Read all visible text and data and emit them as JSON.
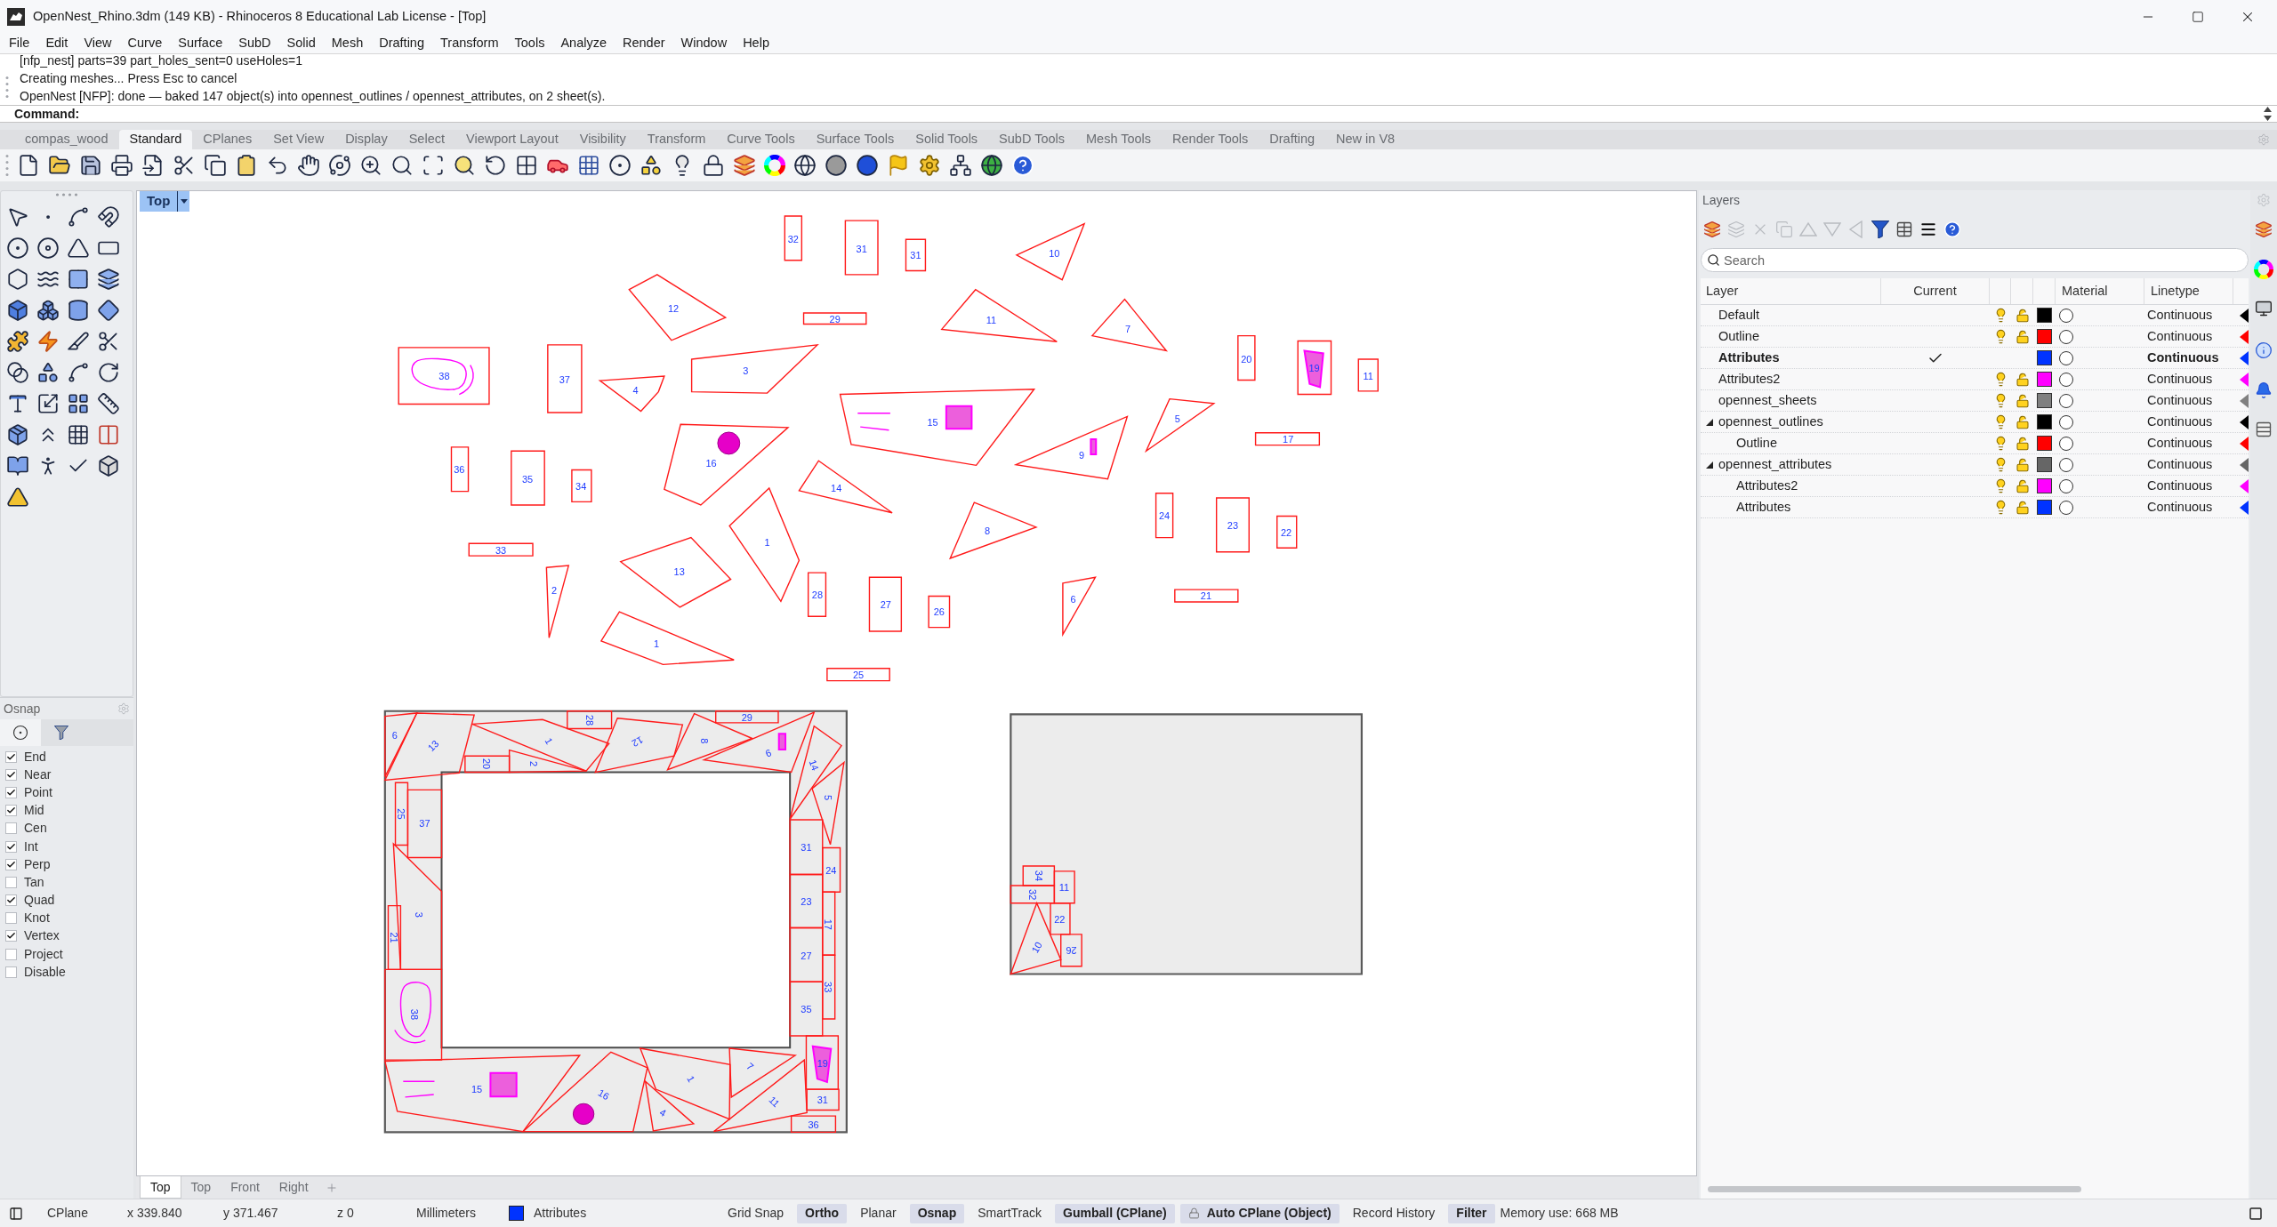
{
  "window": {
    "title": "OpenNest_Rhino.3dm (149 KB) - Rhinoceros 8 Educational Lab License - [Top]"
  },
  "menu": [
    "File",
    "Edit",
    "View",
    "Curve",
    "Surface",
    "SubD",
    "Solid",
    "Mesh",
    "Drafting",
    "Transform",
    "Tools",
    "Analyze",
    "Render",
    "Window",
    "Help"
  ],
  "command_history": [
    "[nfp_nest] parts=39 part_holes_sent=0 useHoles=1",
    "Creating meshes... Press Esc to cancel",
    "OpenNest [NFP]: done — baked 147 object(s) into opennest_outlines / opennest_attributes, on 2 sheet(s)."
  ],
  "command_prompt": "Command:",
  "toolbar_tabs": [
    {
      "label": "compas_wood",
      "selected": false
    },
    {
      "label": "Standard",
      "selected": true
    },
    {
      "label": "CPlanes",
      "selected": false
    },
    {
      "label": "Set View",
      "selected": false
    },
    {
      "label": "Display",
      "selected": false
    },
    {
      "label": "Select",
      "selected": false
    },
    {
      "label": "Viewport Layout",
      "selected": false
    },
    {
      "label": "Visibility",
      "selected": false
    },
    {
      "label": "Transform",
      "selected": false
    },
    {
      "label": "Curve Tools",
      "selected": false
    },
    {
      "label": "Surface Tools",
      "selected": false
    },
    {
      "label": "Solid Tools",
      "selected": false
    },
    {
      "label": "SubD Tools",
      "selected": false
    },
    {
      "label": "Mesh Tools",
      "selected": false
    },
    {
      "label": "Render Tools",
      "selected": false
    },
    {
      "label": "Drafting",
      "selected": false
    },
    {
      "label": "New in V8",
      "selected": false
    }
  ],
  "viewport": {
    "title": "Top",
    "parts": [
      {
        "label": "32"
      },
      {
        "label": "31"
      },
      {
        "label": "31"
      },
      {
        "label": "10"
      },
      {
        "label": "12"
      },
      {
        "label": "29"
      },
      {
        "label": "11"
      },
      {
        "label": "7"
      },
      {
        "label": "38"
      },
      {
        "label": "37"
      },
      {
        "label": "4"
      },
      {
        "label": "3"
      },
      {
        "label": "20"
      },
      {
        "label": "19"
      },
      {
        "label": "11"
      },
      {
        "label": "15"
      },
      {
        "label": "5"
      },
      {
        "label": "17"
      },
      {
        "label": "36"
      },
      {
        "label": "35"
      },
      {
        "label": "34"
      },
      {
        "label": "16"
      },
      {
        "label": "14"
      },
      {
        "label": "9"
      },
      {
        "label": "33"
      },
      {
        "label": "1"
      },
      {
        "label": "8"
      },
      {
        "label": "24"
      },
      {
        "label": "23"
      },
      {
        "label": "22"
      },
      {
        "label": "2"
      },
      {
        "label": "13"
      },
      {
        "label": "28"
      },
      {
        "label": "27"
      },
      {
        "label": "26"
      },
      {
        "label": "6"
      },
      {
        "label": "21"
      },
      {
        "label": "1"
      },
      {
        "label": "25"
      }
    ],
    "sheets": [
      {
        "parts": [
          {
            "label": "28"
          },
          {
            "label": "29"
          },
          {
            "label": "6"
          },
          {
            "label": "13"
          },
          {
            "label": "20"
          },
          {
            "label": "2"
          },
          {
            "label": "1"
          },
          {
            "label": "12"
          },
          {
            "label": "8"
          },
          {
            "label": "9"
          },
          {
            "label": "14"
          },
          {
            "label": "5"
          },
          {
            "label": "25"
          },
          {
            "label": "37"
          },
          {
            "label": "31"
          },
          {
            "label": "24"
          },
          {
            "label": "3"
          },
          {
            "label": "23"
          },
          {
            "label": "21"
          },
          {
            "label": "17"
          },
          {
            "label": "27"
          },
          {
            "label": "33"
          },
          {
            "label": "38"
          },
          {
            "label": "35"
          },
          {
            "label": "15"
          },
          {
            "label": "16"
          },
          {
            "label": "4"
          },
          {
            "label": "1"
          },
          {
            "label": "7"
          },
          {
            "label": "11"
          },
          {
            "label": "36"
          },
          {
            "label": "19"
          },
          {
            "label": "31"
          }
        ]
      },
      {
        "parts": [
          {
            "label": "34"
          },
          {
            "label": "32"
          },
          {
            "label": "11"
          },
          {
            "label": "22"
          },
          {
            "label": "10"
          },
          {
            "label": "26"
          }
        ]
      }
    ]
  },
  "view_tabs": [
    {
      "label": "Top",
      "selected": true
    },
    {
      "label": "Top",
      "selected": false
    },
    {
      "label": "Front",
      "selected": false
    },
    {
      "label": "Right",
      "selected": false
    }
  ],
  "osnap": {
    "title": "Osnap",
    "tabs": [
      {
        "kind": "snap",
        "selected": true
      },
      {
        "kind": "filter",
        "selected": false
      }
    ],
    "items": [
      {
        "label": "End",
        "checked": true
      },
      {
        "label": "Near",
        "checked": true
      },
      {
        "label": "Point",
        "checked": true
      },
      {
        "label": "Mid",
        "checked": true
      },
      {
        "label": "Cen",
        "checked": false
      },
      {
        "label": "Int",
        "checked": true
      },
      {
        "label": "Perp",
        "checked": true
      },
      {
        "label": "Tan",
        "checked": false
      },
      {
        "label": "Quad",
        "checked": true
      },
      {
        "label": "Knot",
        "checked": false
      },
      {
        "label": "Vertex",
        "checked": true
      },
      {
        "label": "Project",
        "checked": false
      },
      {
        "label": "Disable",
        "checked": false
      }
    ]
  },
  "layers": {
    "title": "Layers",
    "search": {
      "placeholder": "Search"
    },
    "columns": {
      "layer": "Layer",
      "current": "Current",
      "material": "Material",
      "linetype": "Linetype"
    },
    "rows": [
      {
        "name": "Default",
        "current": false,
        "visible": true,
        "locked": false,
        "color": "#000000",
        "linetype": "Continuous"
      },
      {
        "name": "Outline",
        "current": false,
        "visible": true,
        "locked": false,
        "color": "#ff0000",
        "linetype": "Continuous"
      },
      {
        "name": "Attributes",
        "current": true,
        "color": "#0033ff",
        "linetype": "Continuous"
      },
      {
        "name": "Attributes2",
        "current": false,
        "visible": true,
        "locked": false,
        "color": "#ff00ff",
        "linetype": "Continuous"
      },
      {
        "name": "opennest_sheets",
        "current": false,
        "visible": true,
        "locked": false,
        "color": "#808080",
        "linetype": "Continuous"
      },
      {
        "name": "opennest_outlines",
        "current": false,
        "visible": true,
        "locked": false,
        "color": "#000000",
        "linetype": "Continuous",
        "expanded": true,
        "children": [
          {
            "name": "Outline",
            "current": false,
            "visible": true,
            "locked": false,
            "color": "#ff0000",
            "linetype": "Continuous"
          }
        ]
      },
      {
        "name": "opennest_attributes",
        "current": false,
        "visible": true,
        "locked": false,
        "color": "#666666",
        "linetype": "Continuous",
        "expanded": true,
        "children": [
          {
            "name": "Attributes2",
            "current": false,
            "visible": true,
            "locked": false,
            "color": "#ff00ff",
            "linetype": "Continuous"
          },
          {
            "name": "Attributes",
            "current": false,
            "visible": true,
            "locked": false,
            "color": "#0033ff",
            "linetype": "Continuous"
          }
        ]
      }
    ]
  },
  "status_bar": {
    "cplane": "CPlane",
    "x": "x 339.840",
    "y": "y 371.467",
    "z": "z 0",
    "units": "Millimeters",
    "layer": {
      "name": "Attributes",
      "color": "#0033ff"
    },
    "toggles": [
      {
        "label": "Grid Snap",
        "on": false,
        "locked": false
      },
      {
        "label": "Ortho",
        "on": true,
        "locked": false
      },
      {
        "label": "Planar",
        "on": false,
        "locked": false
      },
      {
        "label": "Osnap",
        "on": true,
        "locked": false
      },
      {
        "label": "SmartTrack",
        "on": false,
        "locked": false
      },
      {
        "label": "Gumball (CPlane)",
        "on": true,
        "locked": false
      },
      {
        "label": "Auto CPlane (Object)",
        "on": true,
        "locked": true
      },
      {
        "label": "Record History",
        "on": false,
        "locked": false
      },
      {
        "label": "Filter",
        "on": true,
        "locked": false
      }
    ],
    "memory": "Memory use: 668 MB"
  }
}
